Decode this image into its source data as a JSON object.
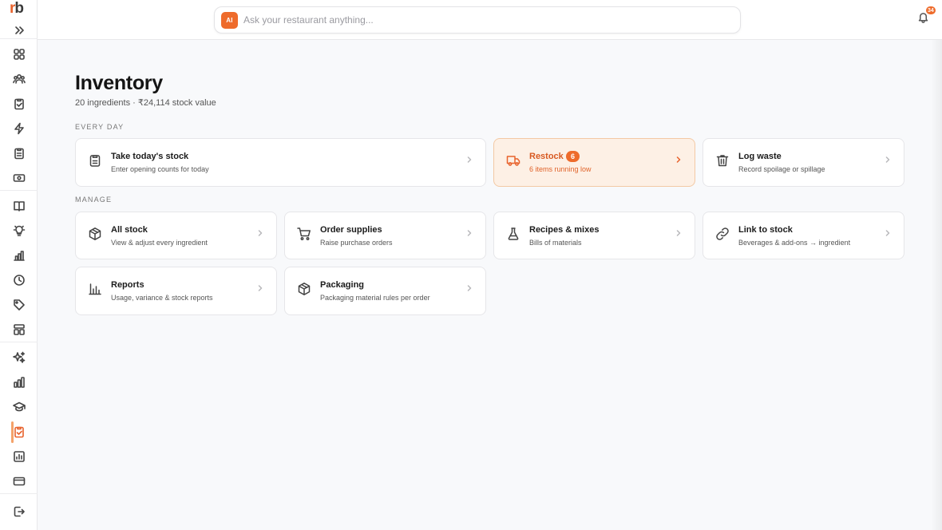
{
  "app": {
    "logo_r": "r",
    "logo_b": "b",
    "brand_color": "#ee6b2b"
  },
  "sidebar": {
    "items": [
      {
        "name": "expand-icon"
      },
      {
        "name": "dashboard-icon"
      },
      {
        "name": "team-icon"
      },
      {
        "name": "orders-icon"
      },
      {
        "name": "lightning-icon"
      },
      {
        "name": "checklist-icon"
      },
      {
        "name": "cash-icon"
      },
      {
        "name": "menu-book-icon"
      },
      {
        "name": "bulb-icon"
      },
      {
        "name": "analytics-icon"
      },
      {
        "name": "clock-icon"
      },
      {
        "name": "tag-icon"
      },
      {
        "name": "layout-icon"
      },
      {
        "name": "sparkle-icon"
      },
      {
        "name": "bar-chart-icon"
      },
      {
        "name": "graduation-icon"
      },
      {
        "name": "inventory-icon",
        "active": true
      },
      {
        "name": "report-icon"
      },
      {
        "name": "card-icon"
      },
      {
        "name": "logout-icon"
      }
    ]
  },
  "topbar": {
    "ai_label": "AI",
    "search_placeholder": "Ask your restaurant anything...",
    "notification_count": "34"
  },
  "page": {
    "title": "Inventory",
    "subtitle": "20 ingredients · ₹24,114 stock value"
  },
  "every_day": {
    "label": "EVERY DAY",
    "cards": [
      {
        "icon": "clipboard-icon",
        "title": "Take today's stock",
        "desc": "Enter opening counts for today"
      },
      {
        "icon": "truck-icon",
        "title": "Restock",
        "badge": "6",
        "desc": "6 items running low",
        "highlight": true
      },
      {
        "icon": "trash-icon",
        "title": "Log waste",
        "desc": "Record spoilage or spillage"
      }
    ]
  },
  "manage": {
    "label": "MANAGE",
    "cards": [
      {
        "icon": "box-icon",
        "title": "All stock",
        "desc": "View & adjust every ingredient"
      },
      {
        "icon": "cart-icon",
        "title": "Order supplies",
        "desc": "Raise purchase orders"
      },
      {
        "icon": "flask-icon",
        "title": "Recipes & mixes",
        "desc": "Bills of materials"
      },
      {
        "icon": "link-icon",
        "title": "Link to stock",
        "desc": "Beverages & add-ons → ingredient"
      },
      {
        "icon": "bar-chart-icon",
        "title": "Reports",
        "desc": "Usage, variance & stock reports"
      },
      {
        "icon": "package-icon",
        "title": "Packaging",
        "desc": "Packaging material rules per order"
      }
    ]
  }
}
